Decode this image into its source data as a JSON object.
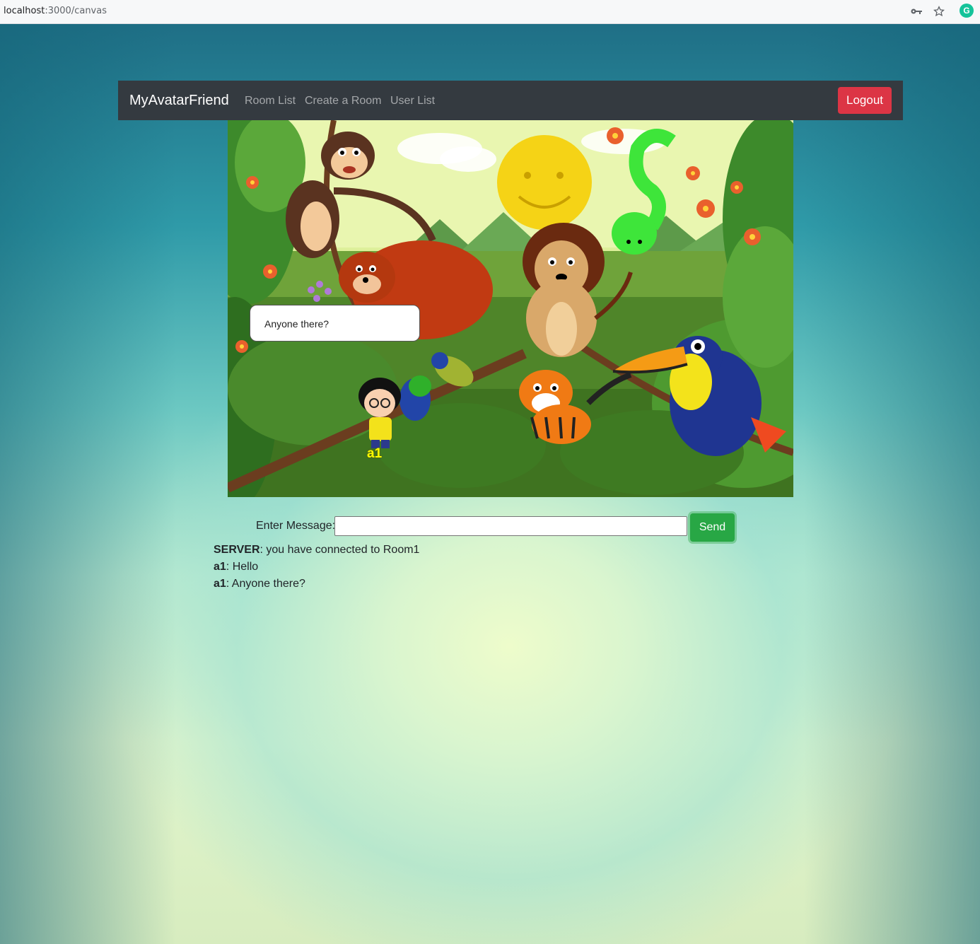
{
  "browser": {
    "url_host": "localhost",
    "url_path": ":3000/canvas"
  },
  "navbar": {
    "brand": "MyAvatarFriend",
    "links": [
      "Room List",
      "Create a Room",
      "User List"
    ],
    "logout_label": "Logout"
  },
  "scene": {
    "speech_text": "Anyone there?",
    "avatar_name": "a1"
  },
  "form": {
    "label": "Enter Message:",
    "input_value": "",
    "send_label": "Send"
  },
  "chat": [
    {
      "sender": "SERVER",
      "text": ": you have connected to Room1"
    },
    {
      "sender": "a1",
      "text": ": Hello"
    },
    {
      "sender": "a1",
      "text": ": Anyone there?"
    }
  ],
  "colors": {
    "navbar": "#343a40",
    "logout": "#dc3545",
    "send": "#28a745"
  },
  "icons": [
    "key-icon",
    "star-icon",
    "grammarly-extension-icon"
  ]
}
